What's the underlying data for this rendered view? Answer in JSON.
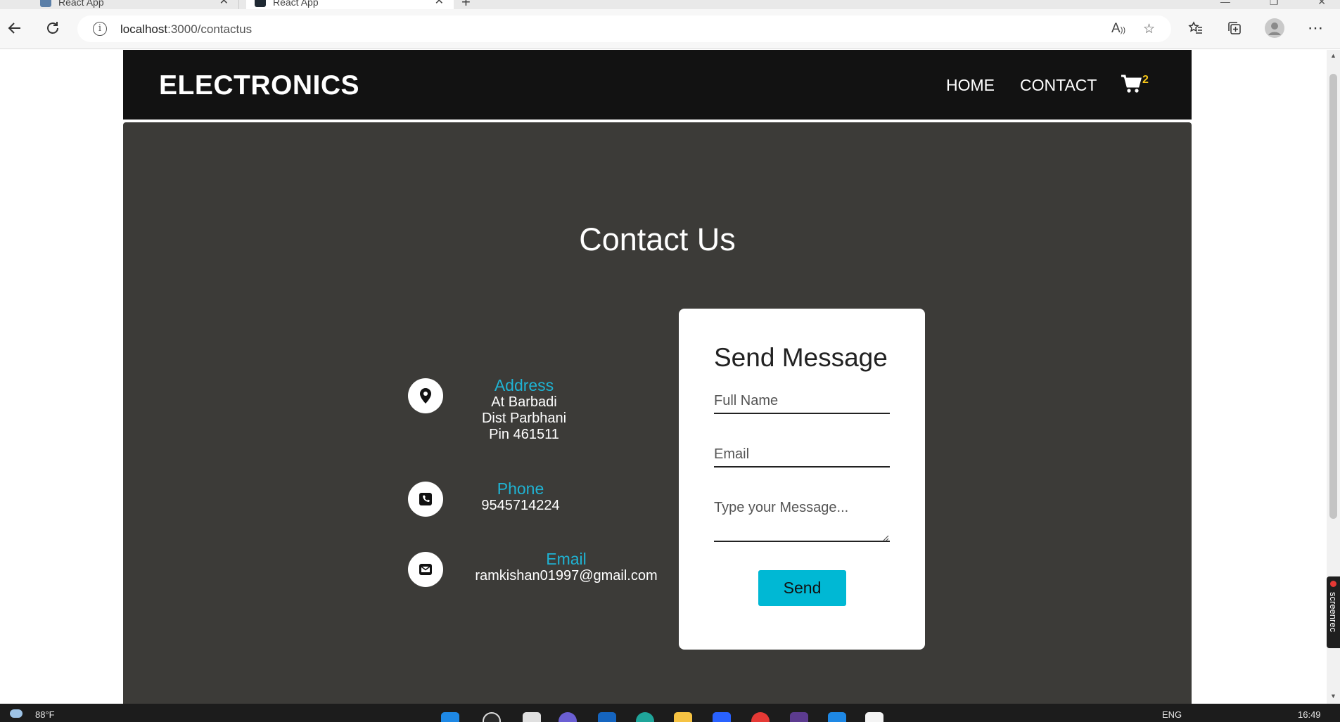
{
  "browser": {
    "tabs": [
      {
        "title": "React App",
        "active": false
      },
      {
        "title": "React App",
        "active": true
      }
    ],
    "url_host": "localhost",
    "url_rest": ":3000/contactus"
  },
  "navbar": {
    "brand": "ELECTRONICS",
    "links": [
      "HOME",
      "CONTACT"
    ],
    "cart_count": "2"
  },
  "contact": {
    "heading": "Contact Us",
    "address": {
      "label": "Address",
      "lines": [
        "At Barbadi",
        "Dist Parbhani",
        "Pin 461511"
      ]
    },
    "phone": {
      "label": "Phone",
      "value": "9545714224"
    },
    "email": {
      "label": "Email",
      "value": "ramkishan01997@gmail.com"
    }
  },
  "form": {
    "title": "Send Message",
    "full_name_placeholder": "Full Name",
    "email_placeholder": "Email",
    "message_placeholder": "Type your Message...",
    "send_label": "Send"
  },
  "screenrec": {
    "label": "screenrec"
  },
  "taskbar": {
    "weather": "88°F",
    "language": "ENG",
    "time": "16:49"
  },
  "colors": {
    "navbar_bg": "#121212",
    "content_bg": "#3c3b38",
    "accent_cyan": "#00b8d4",
    "label_cyan": "#1fb3d3",
    "cart_badge": "#f5c518"
  }
}
